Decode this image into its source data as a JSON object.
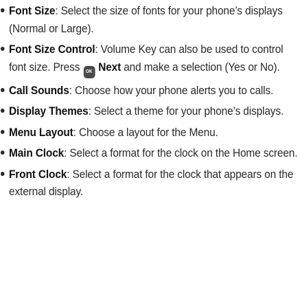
{
  "items": [
    {
      "term": "Font Size",
      "text": ": Select the size of fonts for your phone’s displays (Normal or Large)."
    },
    {
      "term": "Font Size Control",
      "text_before": ": Volume Key can also be used to control font size. Press ",
      "key_label": "OK",
      "bold_inline": "Next",
      "text_after": " and make a selection (Yes or No)."
    },
    {
      "term": "Call Sounds",
      "text": ": Choose how your phone alerts you to calls."
    },
    {
      "term": "Display Themes",
      "text": ": Select a theme for your phone’s displays."
    },
    {
      "term": "Menu Layout",
      "text": ": Choose a layout for the Menu."
    },
    {
      "term": "Main Clock",
      "text": ": Select a format for the clock on the Home screen."
    },
    {
      "term": "Front Clock",
      "text": ": Select a format for the clock that appears on the external display."
    }
  ]
}
